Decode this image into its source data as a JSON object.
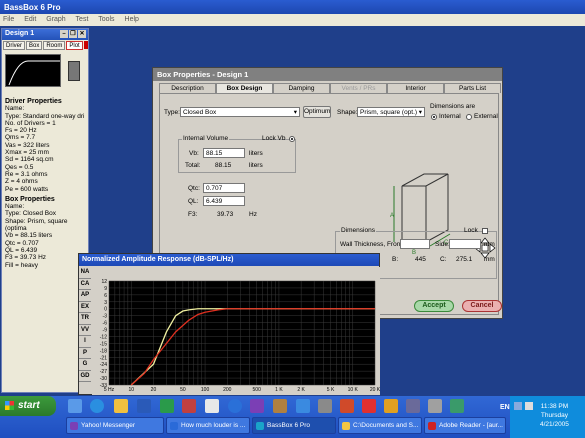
{
  "app": {
    "title": "BassBox 6 Pro",
    "menu": [
      "File",
      "Edit",
      "Graph",
      "Test",
      "Tools",
      "Help"
    ]
  },
  "design_panel": {
    "title": "Design 1",
    "tabs": [
      "Driver",
      "Box",
      "Room",
      "Plot"
    ],
    "driver_header": "Driver Properties",
    "driver_lines": [
      "Name:",
      "Type: Standard one-way dri",
      "No. of Drivers = 1",
      "Fs = 20 Hz",
      "Qms = 7.7",
      "Vas = 322 liters",
      "Xmax = 25 mm",
      "Sd = 1164 sq.cm",
      "Qes = 0.5",
      "Re = 3.1 ohms",
      "Z = 4 ohms",
      "Pe = 600 watts"
    ],
    "box_header": "Box Properties",
    "box_lines": [
      "Name:",
      "Type: Closed Box",
      "Shape: Prism, square (optima",
      "Vb = 88.15 liters",
      "Qtc = 0.707",
      "QL = 6.439",
      "F3 = 39.73 Hz",
      "Fill = heavy"
    ]
  },
  "dialog": {
    "title": "Box Properties - Design 1",
    "tabs": [
      {
        "label": "Description",
        "state": "normal"
      },
      {
        "label": "Box Design",
        "state": "active"
      },
      {
        "label": "Damping",
        "state": "normal"
      },
      {
        "label": "Vents / PRs",
        "state": "dim"
      },
      {
        "label": "Interior",
        "state": "normal"
      },
      {
        "label": "Parts List",
        "state": "normal"
      }
    ],
    "type_label": "Type:",
    "type_value": "Closed Box",
    "optimum_label": "Optimum",
    "shape_label": "Shape:",
    "shape_value": "Prism, square (opt.)",
    "dimensions_are_label": "Dimensions are",
    "internal_label": "Internal",
    "external_label": "External",
    "internal_volume_label": "Internal Volume",
    "lock_vb_label": "Lock Vb",
    "vb_label": "Vb:",
    "vb_value": "88.15",
    "vb_unit": "liters",
    "total_label": "Total:",
    "total_value": "88.15",
    "total_unit": "liters",
    "qtc_label": "Qtc:",
    "qtc_value": "0.707",
    "ql_label": "QL:",
    "ql_value": "6.439",
    "f3_label": "F3:",
    "f3_value": "39.73",
    "f3_unit": "Hz",
    "cube_labels": [
      "A",
      "B",
      "C"
    ],
    "dimensions_label": "Dimensions",
    "lock_label": "Lock",
    "wall_thickness_label": "Wall Thickness, Front:",
    "side_label": "Side:",
    "mm_unit": "mm",
    "b_label": "B:",
    "b_value": "445",
    "c_label": "C:",
    "c_value": "275.1",
    "accept_label": "Accept",
    "cancel_label": "Cancel"
  },
  "amplitude_window": {
    "title": "Normalized Amplitude Response (dB-SPL/Hz)",
    "side_buttons": [
      "NA",
      "CA",
      "AP",
      "EX",
      "TR",
      "VV",
      "I",
      "P",
      "G",
      "GD"
    ]
  },
  "chart_data": {
    "type": "line",
    "title": "",
    "xlabel": "",
    "ylabel": "",
    "x_scale": "log",
    "xlim": [
      10,
      20000
    ],
    "ylim": [
      -36,
      12
    ],
    "x_ticks": [
      "5 Hz",
      "10",
      "20",
      "50",
      "100",
      "200",
      "500",
      "1 K",
      "2 K",
      "5 K",
      "10 K",
      "20 K"
    ],
    "y_ticks": [
      "12",
      "9",
      "6",
      "3",
      "0",
      "-3",
      "-6",
      "-9",
      "-12",
      "-15",
      "-18",
      "-21",
      "-24",
      "-27",
      "-30",
      "-33"
    ],
    "grid": true,
    "series": [
      {
        "color": "#f0f0a0",
        "x": [
          10,
          20,
          30,
          40,
          50,
          60,
          80,
          100,
          200,
          500,
          1000,
          20000
        ],
        "y": [
          -36,
          -24,
          -10,
          -3,
          -1,
          -0.5,
          0,
          0,
          0,
          0,
          0,
          0
        ]
      },
      {
        "color": "#e03020",
        "x": [
          10,
          15,
          20,
          30,
          40,
          60,
          80,
          100,
          150,
          200,
          500,
          1000,
          20000
        ],
        "y": [
          -36,
          -28,
          -22,
          -15,
          -10,
          -5,
          -2.5,
          -1.5,
          -0.5,
          0,
          0,
          0,
          0
        ]
      }
    ]
  },
  "taskbar": {
    "start_label": "start",
    "tasks": [
      {
        "label": "Yahoo! Messenger",
        "color": "#7b3fb5"
      },
      {
        "label": "How much louder is ...",
        "color": "#2a6ad8"
      },
      {
        "label": "BassBox 6 Pro",
        "color": "#1aa3c9"
      },
      {
        "label": "C:\\Documents and S...",
        "color": "#f2c744"
      },
      {
        "label": "Adobe Reader - [aur...",
        "color": "#cc2222"
      }
    ],
    "lang": "EN",
    "time": "11:38 PM",
    "day": "Thursday",
    "date": "4/21/2005"
  }
}
